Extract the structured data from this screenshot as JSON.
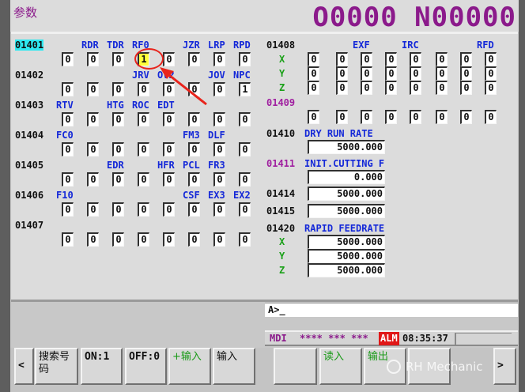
{
  "header": {
    "title": "参数",
    "program": "O0000 N00000"
  },
  "left_params": [
    {
      "num": "01401",
      "selected": true,
      "bits": [
        [
          "",
          ""
        ],
        [
          "RDR",
          "RDR"
        ],
        [
          "TDR",
          "TDR"
        ],
        [
          "RF0",
          "RF0"
        ],
        [
          "",
          ""
        ],
        [
          "JZR",
          "JZR"
        ],
        [
          "LRP",
          "LRP"
        ],
        [
          "RPD",
          "RPD"
        ]
      ],
      "values": [
        "0",
        "0",
        "0",
        "1",
        "0",
        "0",
        "0",
        "0"
      ]
    },
    {
      "num": "01402",
      "bits": [
        [
          "",
          ""
        ],
        [
          "",
          ""
        ],
        [
          "",
          ""
        ],
        [
          "JRV",
          "JRV"
        ],
        [
          "OV2",
          "OV2"
        ],
        [
          "",
          ""
        ],
        [
          "JOV",
          "JOV"
        ],
        [
          "NPC",
          "NPC"
        ]
      ],
      "values": [
        "0",
        "0",
        "0",
        "0",
        "0",
        "0",
        "0",
        "1"
      ]
    },
    {
      "num": "01403",
      "bits": [
        [
          "RTV",
          "RTV"
        ],
        [
          "",
          ""
        ],
        [
          "HTG",
          "HTG"
        ],
        [
          "ROC",
          "ROC"
        ],
        [
          "EDT",
          "EDT"
        ],
        [
          "",
          ""
        ],
        [
          "",
          ""
        ],
        [
          "",
          ""
        ]
      ],
      "values": [
        "0",
        "0",
        "0",
        "0",
        "0",
        "0",
        "0",
        "0"
      ]
    },
    {
      "num": "01404",
      "bits": [
        [
          "FC0",
          "FC0"
        ],
        [
          "",
          ""
        ],
        [
          "",
          ""
        ],
        [
          "",
          ""
        ],
        [
          "",
          ""
        ],
        [
          "FM3",
          "FM3"
        ],
        [
          "DLF",
          "DLF"
        ],
        [
          "",
          ""
        ]
      ],
      "values": [
        "0",
        "0",
        "0",
        "0",
        "0",
        "0",
        "0",
        "0"
      ]
    },
    {
      "num": "01405",
      "bits": [
        [
          "",
          ""
        ],
        [
          "",
          ""
        ],
        [
          "EDR",
          "EDR"
        ],
        [
          "",
          ""
        ],
        [
          "HFR",
          "HFR"
        ],
        [
          "PCL",
          "PCL"
        ],
        [
          "FR3",
          "FR3"
        ],
        [
          "",
          ""
        ]
      ],
      "values": [
        "0",
        "0",
        "0",
        "0",
        "0",
        "0",
        "0",
        "0"
      ]
    },
    {
      "num": "01406",
      "bits": [
        [
          "F10",
          "F10"
        ],
        [
          "",
          ""
        ],
        [
          "",
          ""
        ],
        [
          "",
          ""
        ],
        [
          "",
          ""
        ],
        [
          "CSF",
          "CSF"
        ],
        [
          "EX3",
          "EX3"
        ],
        [
          "EX2",
          "EX2"
        ]
      ],
      "values": [
        "0",
        "0",
        "0",
        "0",
        "0",
        "0",
        "0",
        "0"
      ]
    },
    {
      "num": "01407",
      "bits": [
        [
          "",
          ""
        ],
        [
          "",
          ""
        ],
        [
          "",
          ""
        ],
        [
          "",
          ""
        ],
        [
          "",
          ""
        ],
        [
          "",
          ""
        ],
        [
          "",
          ""
        ],
        [
          "",
          ""
        ]
      ],
      "values": [
        "0",
        "0",
        "0",
        "0",
        "0",
        "0",
        "0",
        "0"
      ]
    }
  ],
  "right_params": {
    "p1408": {
      "num": "01408",
      "bits": [
        "",
        "",
        "EXF",
        "",
        "IRC",
        "",
        "",
        "RFD"
      ],
      "rows": [
        {
          "axis": "X",
          "values": [
            "0",
            "0",
            "0",
            "0",
            "0",
            "0",
            "0",
            "0"
          ]
        },
        {
          "axis": "Y",
          "values": [
            "0",
            "0",
            "0",
            "0",
            "0",
            "0",
            "0",
            "0"
          ]
        },
        {
          "axis": "Z",
          "values": [
            "0",
            "0",
            "0",
            "0",
            "0",
            "0",
            "0",
            "0"
          ]
        }
      ]
    },
    "p1409": {
      "num": "01409",
      "values": [
        "0",
        "0",
        "0",
        "0",
        "0",
        "0",
        "0",
        "0"
      ]
    },
    "p1410": {
      "num": "01410",
      "label": "DRY RUN RATE",
      "value": "5000.000"
    },
    "p1411": {
      "num": "01411",
      "label": "INIT.CUTTING F",
      "value": "0.000"
    },
    "p1414": {
      "num": "01414",
      "value": "5000.000"
    },
    "p1415": {
      "num": "01415",
      "value": "5000.000"
    },
    "p1420": {
      "num": "01420",
      "label": "RAPID FEEDRATE",
      "rows": [
        {
          "axis": "X",
          "value": "5000.000"
        },
        {
          "axis": "Y",
          "value": "5000.000"
        },
        {
          "axis": "Z",
          "value": "5000.000"
        }
      ]
    }
  },
  "command_line": "A>_",
  "status": {
    "mode": "MDI",
    "stars": "**** *** ***",
    "alarm": "ALM",
    "time": "08:35:37"
  },
  "softkeys": {
    "prev": "<",
    "k1": "搜索号码",
    "k2": "ON:1",
    "k3": "OFF:0",
    "k4": "+输入",
    "k5": "输入",
    "k6": "",
    "k7": "读入",
    "k8": "输出",
    "k9": "",
    "next": ">"
  },
  "watermark": "RH Mechanic",
  "colors": {
    "bit_label": "#1428d8",
    "axis_label": "#1aa018",
    "header": "#8b1a8b",
    "highlight": "#ffff3c",
    "selected": "#2ee8f0",
    "annotation": "#e8241c"
  }
}
